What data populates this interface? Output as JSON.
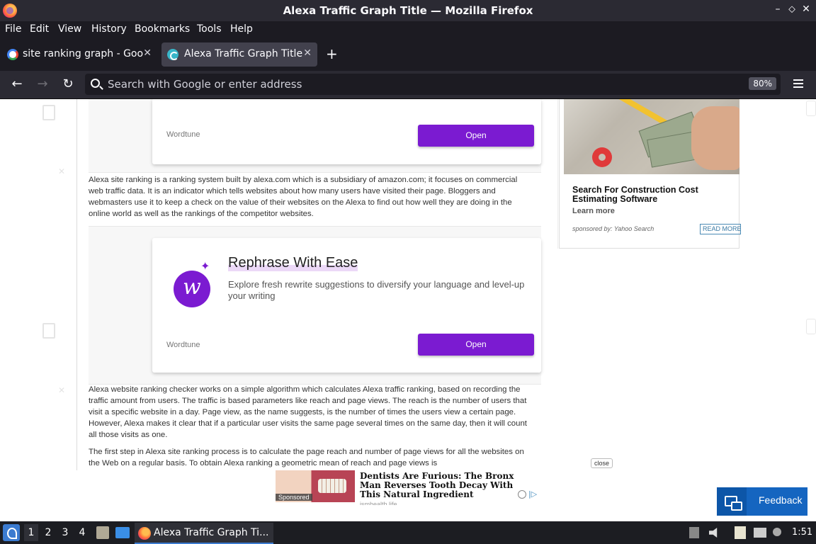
{
  "window": {
    "title": "Alexa Traffic Graph Title — Mozilla Firefox",
    "minimize": "–",
    "maximize": "⬦",
    "close": "✕"
  },
  "menu": [
    "File",
    "Edit",
    "View",
    "History",
    "Bookmarks",
    "Tools",
    "Help"
  ],
  "tabs": [
    {
      "label": "site ranking graph - Google",
      "close": "✕"
    },
    {
      "label": "Alexa Traffic Graph Title",
      "close": "✕"
    }
  ],
  "new_tab": "+",
  "nav": {
    "back": "←",
    "forward": "→",
    "reload": "↻",
    "search_placeholder": "Search with Google or enter address",
    "zoom": "80%"
  },
  "ad_top": {
    "brand": "Wordtune",
    "button": "Open"
  },
  "paragraphs": {
    "p1": "Alexa site ranking is a ranking system built by alexa.com which is a subsidiary of amazon.com; it focuses on commercial web traffic data. It is an indicator which tells websites about how many users have visited their page. Bloggers and webmasters use it to keep a check on the value of their websites on the Alexa to find out how well they are doing in the online world as well as the rankings of the competitor websites.",
    "p2": "Alexa website ranking checker works on a simple algorithm which calculates Alexa traffic ranking, based on recording the traffic amount from users. The traffic is based parameters like reach and page views. The reach is the number of users that visit a specific website in a day. Page view, as the name suggests, is the number of times the users view a certain page. However, Alexa makes it clear that if a particular user visits the same page several times on the same day, then it will count all those visits as one.",
    "p3": "The first step in Alexa site ranking process is to calculate the page reach and number of page views for all the websites on the Web on a regular basis. To obtain Alexa ranking a geometric mean of reach and page views is"
  },
  "ad_mid": {
    "logo_letter": "w",
    "sparkle": "✦",
    "headline": "Rephrase With Ease",
    "description": "Explore fresh rewrite suggestions to diversify your language and level-up your writing",
    "brand": "Wordtune",
    "button": "Open"
  },
  "right_ad": {
    "title": "Search For Construction Cost Estimating Software",
    "learn_more": "Learn more",
    "sponsored_by": "sponsored by: Yahoo Search",
    "read_more": "READ MORE"
  },
  "bottom_ad": {
    "close": "close",
    "sponsored": "Sponsored",
    "headline": "Dentists Are Furious: The Bronx Man Reverses Tooth Decay With This Natural Ingredient",
    "source": "ismhealth.life",
    "adchoices": "|▷"
  },
  "feedback": {
    "label": "Feedback"
  },
  "taskbar": {
    "workspaces": [
      "1",
      "2",
      "3",
      "4"
    ],
    "active_task": "Alexa Traffic Graph Ti...",
    "clock": "1:51"
  }
}
